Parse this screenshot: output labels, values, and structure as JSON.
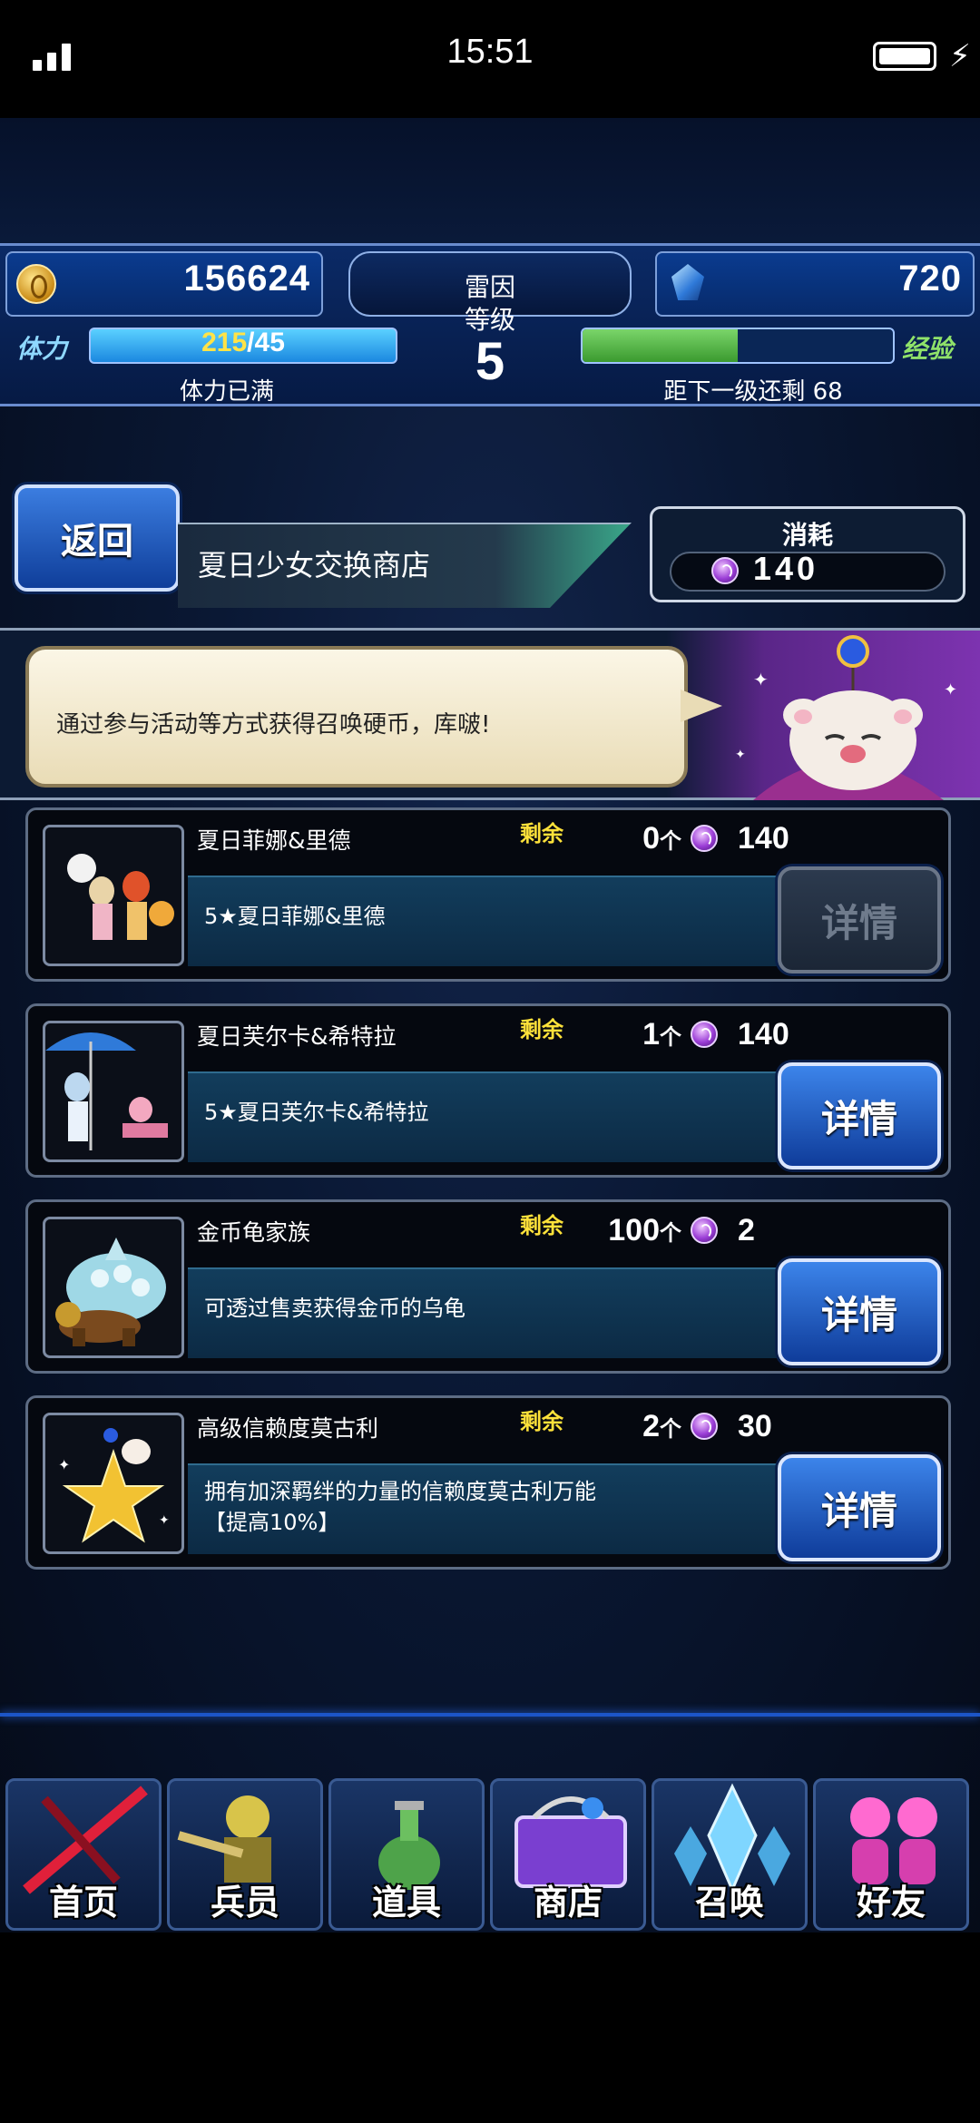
{
  "status_bar": {
    "time": "15:51"
  },
  "header": {
    "gil": "156624",
    "gems": "720",
    "player_name": "雷因",
    "level_label": "等级",
    "level": "5",
    "stamina_label": "体力",
    "stamina_current": "215",
    "stamina_max": "/45",
    "stamina_status": "体力已满",
    "exp_label": "经验",
    "exp_progress": 0.5,
    "exp_next": "距下一级还剩 68"
  },
  "shop": {
    "back_label": "返回",
    "title": "夏日少女交换商店",
    "cost_label": "消耗",
    "cost_value": "140",
    "moogle_message": "通过参与活动等方式获得召唤硬币，库啵!"
  },
  "items": [
    {
      "name": "夏日菲娜&里德",
      "remain_label": "剩余",
      "remain": "0",
      "unit": "个",
      "cost": "140",
      "desc": "5★夏日菲娜&里德",
      "button": "详情",
      "enabled": false
    },
    {
      "name": "夏日芙尔卡&希特拉",
      "remain_label": "剩余",
      "remain": "1",
      "unit": "个",
      "cost": "140",
      "desc": "5★夏日芙尔卡&希特拉",
      "button": "详情",
      "enabled": true
    },
    {
      "name": "金币龟家族",
      "remain_label": "剩余",
      "remain": "100",
      "unit": "个",
      "cost": "2",
      "desc": "可透过售卖获得金币的乌龟",
      "button": "详情",
      "enabled": true
    },
    {
      "name": "高级信赖度莫古利",
      "remain_label": "剩余",
      "remain": "2",
      "unit": "个",
      "cost": "30",
      "desc": "拥有加深羁绊的力量的信赖度莫古利万能",
      "desc2": "【提高10%】",
      "button": "详情",
      "enabled": true
    }
  ],
  "nav": [
    {
      "label": "首页",
      "icon": "sword-icon"
    },
    {
      "label": "兵员",
      "icon": "warrior-icon"
    },
    {
      "label": "道具",
      "icon": "potion-icon"
    },
    {
      "label": "商店",
      "icon": "shop-bag-icon"
    },
    {
      "label": "召唤",
      "icon": "crystal-icon"
    },
    {
      "label": "好友",
      "icon": "friends-icon"
    }
  ]
}
